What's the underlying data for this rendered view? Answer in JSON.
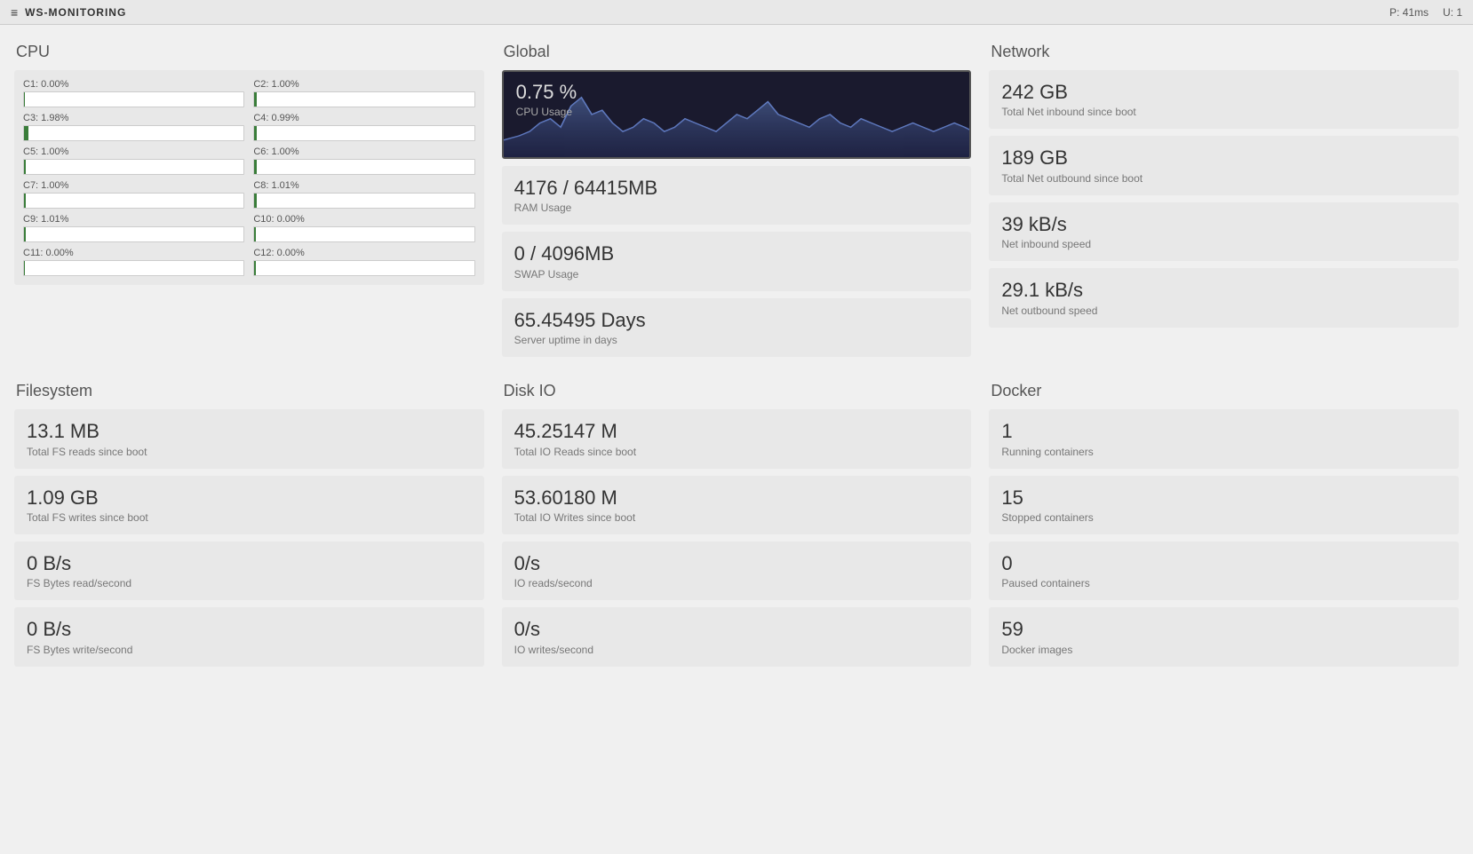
{
  "titlebar": {
    "icon": "≡",
    "title": "WS-MONITORING",
    "ping": "P: 41ms",
    "uptime": "U: 1"
  },
  "cpu": {
    "section_title": "CPU",
    "cores": [
      {
        "label": "C1: 0.00%",
        "value": 0
      },
      {
        "label": "C2: 1.00%",
        "value": 1
      },
      {
        "label": "C3: 1.98%",
        "value": 2
      },
      {
        "label": "C4: 0.99%",
        "value": 1
      },
      {
        "label": "C5: 1.00%",
        "value": 1
      },
      {
        "label": "C6: 1.00%",
        "value": 1
      },
      {
        "label": "C7: 1.00%",
        "value": 1
      },
      {
        "label": "C8: 1.01%",
        "value": 1
      },
      {
        "label": "C9: 1.01%",
        "value": 1
      },
      {
        "label": "C10: 0.00%",
        "value": 0
      },
      {
        "label": "C11: 0.00%",
        "value": 0
      },
      {
        "label": "C12: 0.00%",
        "value": 0
      }
    ]
  },
  "global": {
    "section_title": "Global",
    "cpu_usage_value": "0.75 %",
    "cpu_usage_label": "CPU Usage",
    "ram_value": "4176 / 64415MB",
    "ram_label": "RAM Usage",
    "swap_value": "0 / 4096MB",
    "swap_label": "SWAP Usage",
    "uptime_value": "65.45495 Days",
    "uptime_label": "Server uptime in days"
  },
  "network": {
    "section_title": "Network",
    "inbound_value": "242 GB",
    "inbound_label": "Total Net inbound since boot",
    "outbound_value": "189 GB",
    "outbound_label": "Total Net outbound since boot",
    "inbound_speed_value": "39 kB/s",
    "inbound_speed_label": "Net inbound speed",
    "outbound_speed_value": "29.1 kB/s",
    "outbound_speed_label": "Net outbound speed"
  },
  "filesystem": {
    "section_title": "Filesystem",
    "reads_value": "13.1 MB",
    "reads_label": "Total FS reads since boot",
    "writes_value": "1.09 GB",
    "writes_label": "Total FS writes since boot",
    "read_speed_value": "0 B/s",
    "read_speed_label": "FS Bytes read/second",
    "write_speed_value": "0 B/s",
    "write_speed_label": "FS Bytes write/second"
  },
  "diskio": {
    "section_title": "Disk IO",
    "total_reads_value": "45.25147 M",
    "total_reads_label": "Total IO Reads since boot",
    "total_writes_value": "53.60180 M",
    "total_writes_label": "Total IO Writes since boot",
    "read_speed_value": "0/s",
    "read_speed_label": "IO reads/second",
    "write_speed_value": "0/s",
    "write_speed_label": "IO writes/second"
  },
  "docker": {
    "section_title": "Docker",
    "running_value": "1",
    "running_label": "Running containers",
    "stopped_value": "15",
    "stopped_label": "Stopped containers",
    "paused_value": "0",
    "paused_label": "Paused containers",
    "images_value": "59",
    "images_label": "Docker images"
  }
}
